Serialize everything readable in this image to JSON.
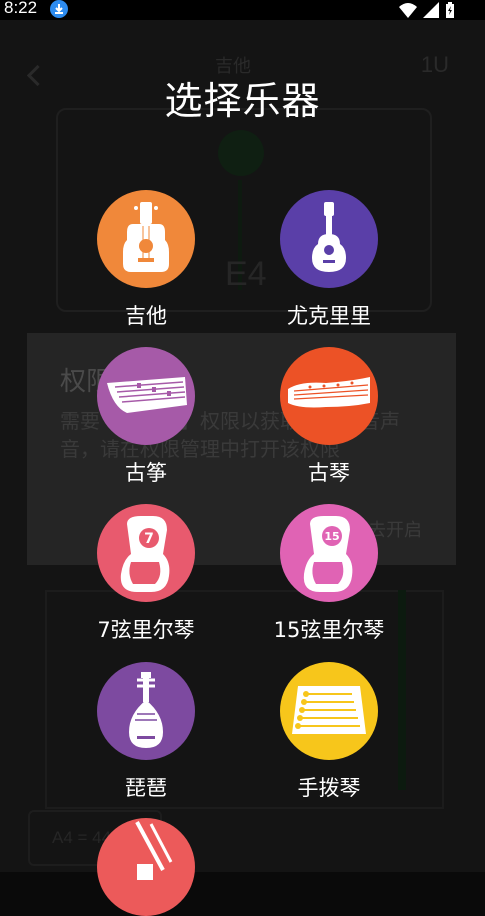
{
  "status_bar": {
    "time": "8:22"
  },
  "background_app": {
    "title": "吉他",
    "right_label": "1U",
    "note": "E4",
    "reference_pitch": "A4 = 440",
    "permission_dialog": {
      "title": "权限",
      "message": "需要【麦克风】权限以获取乐器调音声音，请在权限管理中打开该权限",
      "action": "去开启"
    }
  },
  "picker": {
    "title": "选择乐器",
    "instruments": [
      {
        "label": "吉他",
        "color": "#f0883a",
        "icon": "guitar-icon"
      },
      {
        "label": "尤克里里",
        "color": "#5a3fa8",
        "icon": "ukulele-icon"
      },
      {
        "label": "古筝",
        "color": "#a65aa8",
        "icon": "guzheng-icon"
      },
      {
        "label": "古琴",
        "color": "#ec5226",
        "icon": "guqin-icon"
      },
      {
        "label": "7弦里尔琴",
        "color": "#e85a6e",
        "icon": "lyre-7-icon"
      },
      {
        "label": "15弦里尔琴",
        "color": "#e063b4",
        "icon": "lyre-15-icon"
      },
      {
        "label": "琵琶",
        "color": "#7d4aa0",
        "icon": "pipa-icon"
      },
      {
        "label": "手拨琴",
        "color": "#f7c61b",
        "icon": "kalimba-icon"
      },
      {
        "label": "",
        "color": "#ec5a5a",
        "icon": "erhu-icon"
      }
    ]
  }
}
